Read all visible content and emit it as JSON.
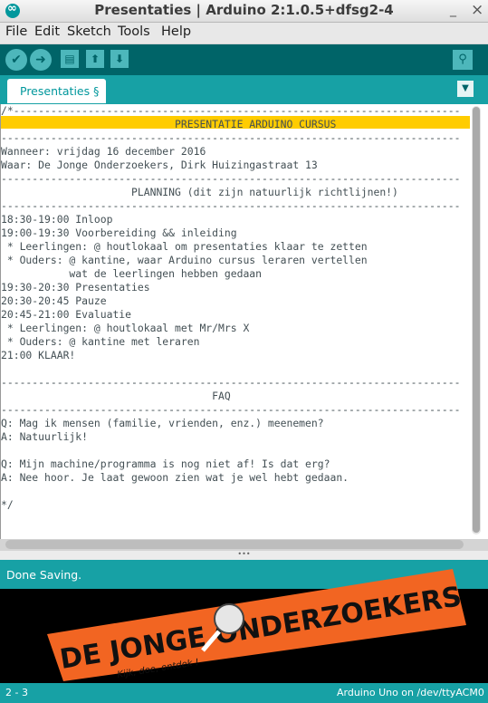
{
  "window": {
    "title": "Presentaties | Arduino 2:1.0.5+dfsg2-4",
    "minimize": "_",
    "close": "×"
  },
  "menu": [
    "File",
    "Edit",
    "Sketch",
    "Tools",
    "Help"
  ],
  "toolbar": {
    "verify_icon": "checkmark-icon",
    "upload_icon": "arrow-right-icon",
    "new_icon": "document-icon",
    "open_icon": "arrow-up-icon",
    "save_icon": "arrow-down-icon",
    "serial_icon": "magnifier-icon"
  },
  "tabs": [
    {
      "label": "Presentaties §"
    }
  ],
  "editor": {
    "lines": [
      "/*------------------------------------------------------------------------",
      "                            PRESENTATIE ARDUINO CURSUS",
      "--------------------------------------------------------------------------",
      "Wanneer: vrijdag 16 december 2016",
      "Waar: De Jonge Onderzoekers, Dirk Huizingastraat 13",
      "--------------------------------------------------------------------------",
      "                     PLANNING (dit zijn natuurlijk richtlijnen!)",
      "--------------------------------------------------------------------------",
      "18:30-19:00 Inloop",
      "19:00-19:30 Voorbereiding && inleiding",
      " * Leerlingen: @ houtlokaal om presentaties klaar te zetten",
      " * Ouders: @ kantine, waar Arduino cursus leraren vertellen",
      "           wat de leerlingen hebben gedaan",
      "19:30-20:30 Presentaties",
      "20:30-20:45 Pauze",
      "20:45-21:00 Evaluatie",
      " * Leerlingen: @ houtlokaal met Mr/Mrs X",
      " * Ouders: @ kantine met leraren",
      "21:00 KLAAR!",
      "",
      "--------------------------------------------------------------------------",
      "                                  FAQ",
      "--------------------------------------------------------------------------",
      "Q: Mag ik mensen (familie, vrienden, enz.) meenemen?",
      "A: Natuurlijk!",
      "",
      "Q: Mijn machine/programma is nog niet af! Is dat erg?",
      "A: Nee hoor. Je laat gewoon zien wat je wel hebt gedaan.",
      "",
      "*/"
    ]
  },
  "status": {
    "message": "Done Saving."
  },
  "splitter_label": "•••",
  "console": {
    "logo_text": "DE JONGE ONDERZOEKERS",
    "logo_tagline": "Kijk, doe, ontdek !"
  },
  "footer": {
    "line": "2 - 3",
    "board": "Arduino Uno on /dev/ttyACM0"
  },
  "colors": {
    "toolbar": "#006468",
    "tabbar": "#17a1a5",
    "highlight": "#ffcc00",
    "logo_orange": "#f26522"
  }
}
